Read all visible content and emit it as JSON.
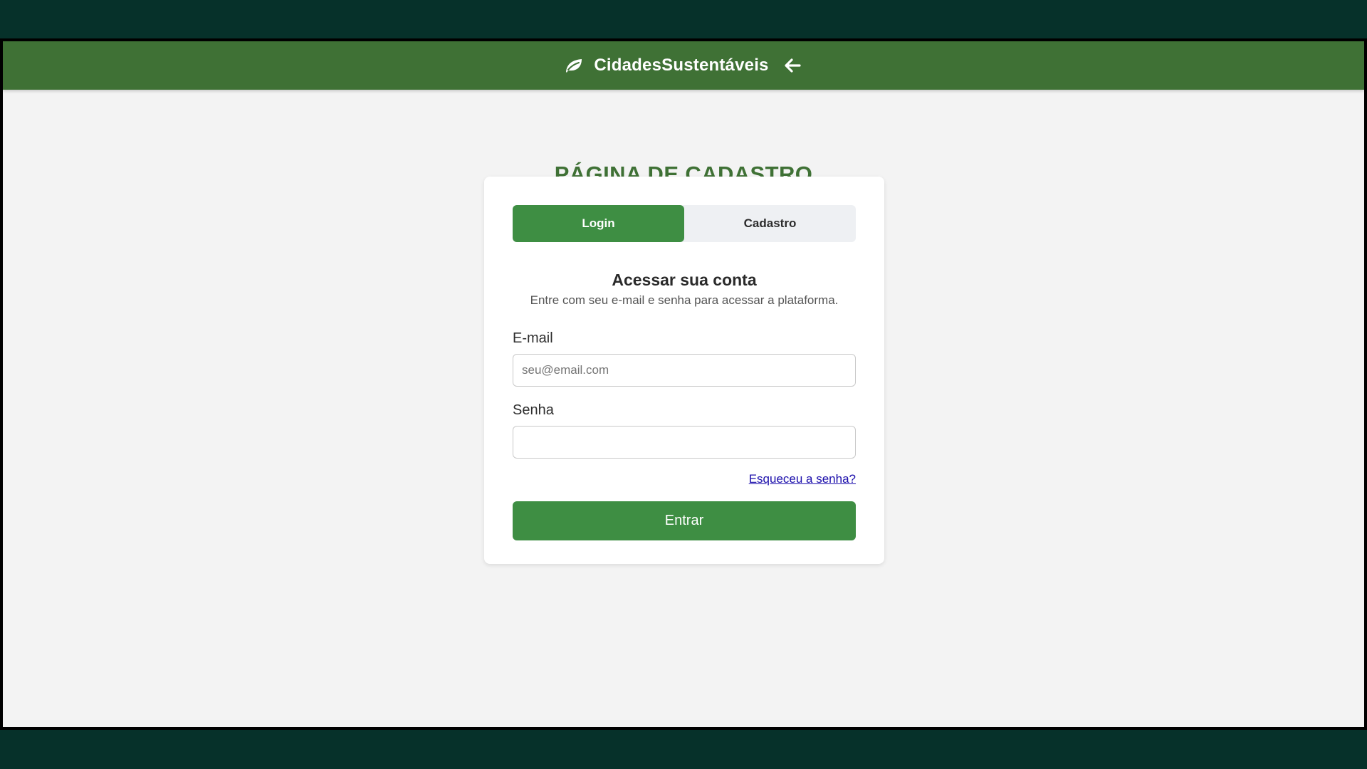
{
  "header": {
    "brand": "CidadesSustentáveis",
    "logo_icon": "leaf-icon",
    "back_icon": "arrow-left-icon"
  },
  "page": {
    "title": "PÁGINA DE CADASTRO"
  },
  "tabs": [
    {
      "label": "Login",
      "active": true
    },
    {
      "label": "Cadastro",
      "active": false
    }
  ],
  "form": {
    "heading": "Acessar sua conta",
    "subheading": "Entre com seu e-mail e senha para acessar a plataforma.",
    "email_label": "E-mail",
    "email_placeholder": "seu@email.com",
    "email_value": "",
    "password_label": "Senha",
    "password_value": "",
    "forgot_label": "Esqueceu a senha?",
    "submit_label": "Entrar"
  },
  "colors": {
    "outer_background": "#06312a",
    "header": "#3f7135",
    "accent": "#3e8e43",
    "title": "#3f7135",
    "link": "#1a0dab"
  }
}
